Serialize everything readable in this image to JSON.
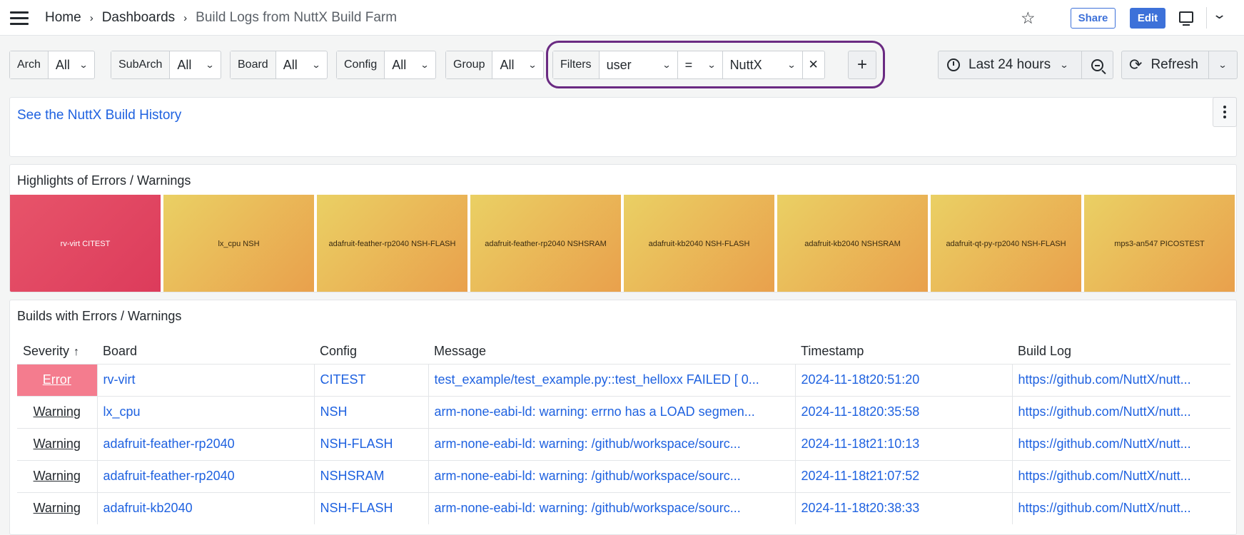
{
  "breadcrumbs": [
    "Home",
    "Dashboards",
    "Build Logs from NuttX Build Farm"
  ],
  "header": {
    "share_label": "Share",
    "edit_label": "Edit"
  },
  "variables": [
    {
      "label": "Arch",
      "value": "All"
    },
    {
      "label": "SubArch",
      "value": "All"
    },
    {
      "label": "Board",
      "value": "All"
    },
    {
      "label": "Config",
      "value": "All"
    },
    {
      "label": "Group",
      "value": "All"
    }
  ],
  "filters": {
    "label": "Filters",
    "key": "user",
    "op": "=",
    "value": "NuttX"
  },
  "time_range": "Last 24 hours",
  "refresh_label": "Refresh",
  "history_link": "See the NuttX Build History",
  "highlights": {
    "title": "Highlights of Errors / Warnings",
    "tiles": [
      {
        "text": "rv-virt CITEST",
        "kind": "error"
      },
      {
        "text": "lx_cpu NSH",
        "kind": "warn"
      },
      {
        "text": "adafruit-feather-rp2040 NSH-FLASH",
        "kind": "warn"
      },
      {
        "text": "adafruit-feather-rp2040 NSHSRAM",
        "kind": "warn"
      },
      {
        "text": "adafruit-kb2040 NSH-FLASH",
        "kind": "warn"
      },
      {
        "text": "adafruit-kb2040 NSHSRAM",
        "kind": "warn"
      },
      {
        "text": "adafruit-qt-py-rp2040 NSH-FLASH",
        "kind": "warn"
      },
      {
        "text": "mps3-an547 PICOSTEST",
        "kind": "warn"
      }
    ]
  },
  "builds": {
    "title": "Builds with Errors / Warnings",
    "columns": [
      "Severity",
      "Board",
      "Config",
      "Message",
      "Timestamp",
      "Build Log"
    ],
    "rows": [
      [
        "Error",
        "rv-virt",
        "CITEST",
        "test_example/test_example.py::test_helloxx FAILED [ 0...",
        "2024-11-18t20:51:20",
        "https://github.com/NuttX/nutt..."
      ],
      [
        "Warning",
        "lx_cpu",
        "NSH",
        "arm-none-eabi-ld: warning: errno has a LOAD segmen...",
        "2024-11-18t20:35:58",
        "https://github.com/NuttX/nutt..."
      ],
      [
        "Warning",
        "adafruit-feather-rp2040",
        "NSH-FLASH",
        "arm-none-eabi-ld: warning: /github/workspace/sourc...",
        "2024-11-18t21:10:13",
        "https://github.com/NuttX/nutt..."
      ],
      [
        "Warning",
        "adafruit-feather-rp2040",
        "NSHSRAM",
        "arm-none-eabi-ld: warning: /github/workspace/sourc...",
        "2024-11-18t21:07:52",
        "https://github.com/NuttX/nutt..."
      ],
      [
        "Warning",
        "adafruit-kb2040",
        "NSH-FLASH",
        "arm-none-eabi-ld: warning: /github/workspace/sourc...",
        "2024-11-18t20:38:33",
        "https://github.com/NuttX/nutt..."
      ]
    ]
  }
}
